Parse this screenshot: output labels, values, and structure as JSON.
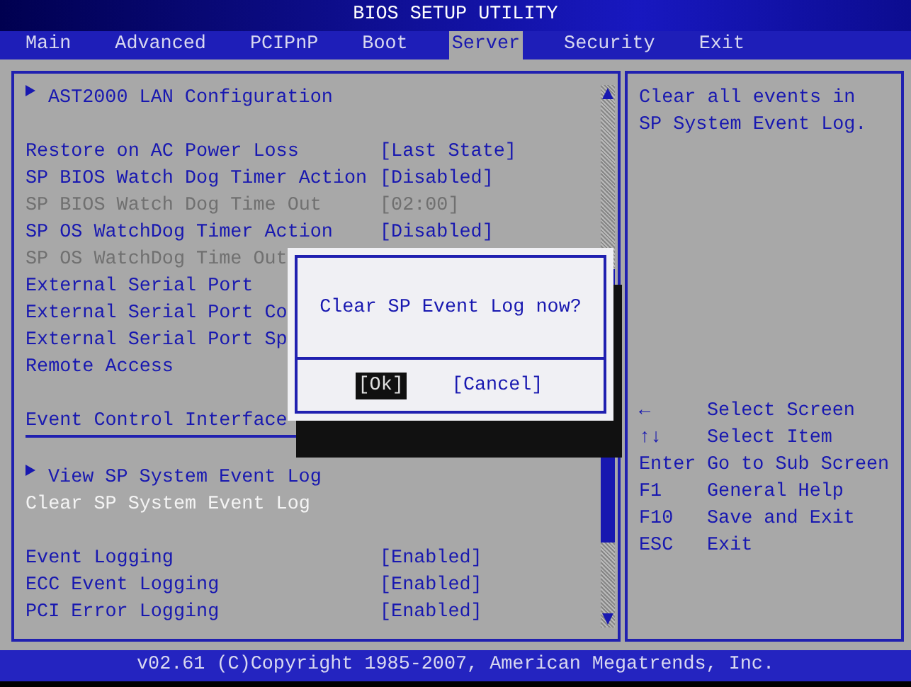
{
  "window": {
    "title": "BIOS SETUP UTILITY"
  },
  "tabs": [
    {
      "label": "Main",
      "selected": false
    },
    {
      "label": "Advanced",
      "selected": false
    },
    {
      "label": "PCIPnP",
      "selected": false
    },
    {
      "label": "Boot",
      "selected": false
    },
    {
      "label": "Server",
      "selected": true
    },
    {
      "label": "Security",
      "selected": false
    },
    {
      "label": "Exit",
      "selected": false
    }
  ],
  "settings": {
    "sections": [
      {
        "items": [
          {
            "kind": "submenu",
            "label": "AST2000 LAN Configuration",
            "selected": false,
            "disabled": false
          }
        ]
      },
      {
        "items": [
          {
            "kind": "option",
            "label": "Restore on AC Power Loss",
            "value": "[Last State]",
            "selected": false,
            "disabled": false
          },
          {
            "kind": "option",
            "label": "SP BIOS Watch Dog Timer Action",
            "value": "[Disabled]",
            "selected": false,
            "disabled": false
          },
          {
            "kind": "option",
            "label": "SP BIOS Watch Dog Time Out",
            "value": "[02:00]",
            "selected": false,
            "disabled": true
          },
          {
            "kind": "option",
            "label": "SP OS WatchDog Timer Action",
            "value": "[Disabled]",
            "selected": false,
            "disabled": false
          },
          {
            "kind": "option",
            "label": "SP OS WatchDog Time Out",
            "selected": false,
            "disabled": true
          },
          {
            "kind": "option",
            "label": "External Serial Port",
            "selected": false,
            "disabled": false
          },
          {
            "kind": "option",
            "label": "External Serial Port Co",
            "selected": false,
            "disabled": false
          },
          {
            "kind": "option",
            "label": "External Serial Port Sp",
            "selected": false,
            "disabled": false
          },
          {
            "kind": "option",
            "label": "Remote Access",
            "selected": false,
            "disabled": false
          }
        ]
      },
      {
        "items": [
          {
            "kind": "header",
            "label": "Event Control Interface"
          }
        ]
      },
      {
        "items": [
          {
            "kind": "submenu",
            "label": "View SP System Event Log",
            "selected": false,
            "disabled": false
          },
          {
            "kind": "action",
            "label": "Clear SP System Event Log",
            "selected": true,
            "disabled": false
          }
        ]
      },
      {
        "items": [
          {
            "kind": "option",
            "label": "Event Logging",
            "value": "[Enabled]",
            "selected": false,
            "disabled": false
          },
          {
            "kind": "option",
            "label": "ECC Event Logging",
            "value": "[Enabled]",
            "selected": false,
            "disabled": false
          },
          {
            "kind": "option",
            "label": "PCI Error Logging",
            "value": "[Enabled]",
            "selected": false,
            "disabled": false
          }
        ]
      }
    ]
  },
  "help": {
    "lines": [
      "Clear all events in",
      "SP System Event Log."
    ],
    "keys": [
      {
        "key": "←",
        "action": "Select Screen"
      },
      {
        "key": "↑↓",
        "action": "Select Item"
      },
      {
        "key": "Enter",
        "action": "Go to Sub Screen"
      },
      {
        "key": "F1",
        "action": "General Help"
      },
      {
        "key": "F10",
        "action": "Save and Exit"
      },
      {
        "key": "ESC",
        "action": "Exit"
      }
    ]
  },
  "dialog": {
    "message": "Clear SP Event Log now?",
    "buttons": [
      {
        "label": "[Ok]",
        "selected": true
      },
      {
        "label": "[Cancel]",
        "selected": false
      }
    ]
  },
  "status_bar": "v02.61 (C)Copyright 1985-2007, American Megatrends, Inc."
}
